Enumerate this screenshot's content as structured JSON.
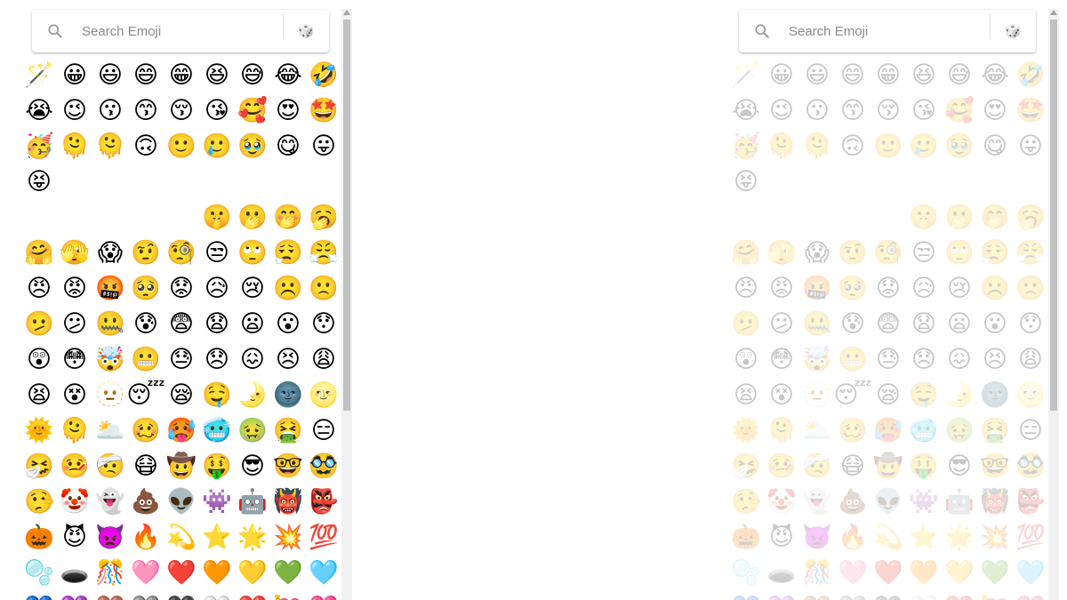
{
  "search": {
    "placeholder": "Search Emoji",
    "value": "",
    "random_icon": "🎲"
  },
  "colors": {
    "scroll_thumb": "#c1c1c1",
    "scroll_track": "#f1f1f1",
    "placeholder_text": "#8a8a8a"
  },
  "rows": [
    [
      "🪄",
      "😀",
      "😃",
      "😄",
      "😁",
      "😆",
      "😅",
      "😂",
      "🤣"
    ],
    [
      "😭",
      "😉",
      "😗",
      "😙",
      "😚",
      "😘",
      "🥰",
      "😍",
      "🤩"
    ],
    [
      "🥳",
      "🫠",
      "🫠",
      "🙃",
      "🙂",
      "🥲",
      "🥹",
      "😋",
      "😛"
    ],
    [
      "😝"
    ],
    [
      null,
      null,
      null,
      null,
      null,
      "🤫",
      "🫢",
      "🤭",
      "🥱"
    ],
    [
      "🤗",
      "🫣",
      "😱",
      "🤨",
      "🧐",
      "😒",
      "🙄",
      "😮‍💨",
      "😤"
    ],
    [
      "😠",
      "😡",
      "🤬",
      "🥺",
      "😟",
      "😥",
      "😢",
      "☹️",
      "🙁"
    ],
    [
      "🫤",
      "😕",
      "🤐",
      "😰",
      "😨",
      "😧",
      "😦",
      "😮",
      "😯"
    ],
    [
      "😲",
      "😳",
      "🤯",
      "😬",
      "😓",
      "😞",
      "😖",
      "😣",
      "😩"
    ],
    [
      "😫",
      "😵",
      "🫥",
      "😴",
      "😪",
      "🤤",
      "🌛",
      "🌚",
      "🌝"
    ],
    [
      "🌞",
      "🫠",
      "🌥️",
      "🥴",
      "🥵",
      "🥶",
      "🤢",
      "🤮",
      "😑"
    ],
    [
      "🤧",
      "🤒",
      "🤕",
      "😷",
      "🤠",
      "🤑",
      "😎",
      "🤓",
      "🥸"
    ],
    [
      "🤥",
      "🤡",
      "👻",
      "💩",
      "👽",
      "👾",
      "🤖",
      "👹",
      "👺"
    ],
    [
      "🎃",
      "😈",
      "👿",
      "🔥",
      "💫",
      "⭐",
      "🌟",
      "💥",
      "💯"
    ],
    [
      "🫧",
      "🕳️",
      "🎊",
      "🩷",
      "❤️",
      "🧡",
      "💛",
      "💚",
      "🩵"
    ],
    [
      "💙",
      "💜",
      "🤎",
      "🩶",
      "🖤",
      "🤍",
      "❤️",
      "💘",
      "💝"
    ]
  ]
}
